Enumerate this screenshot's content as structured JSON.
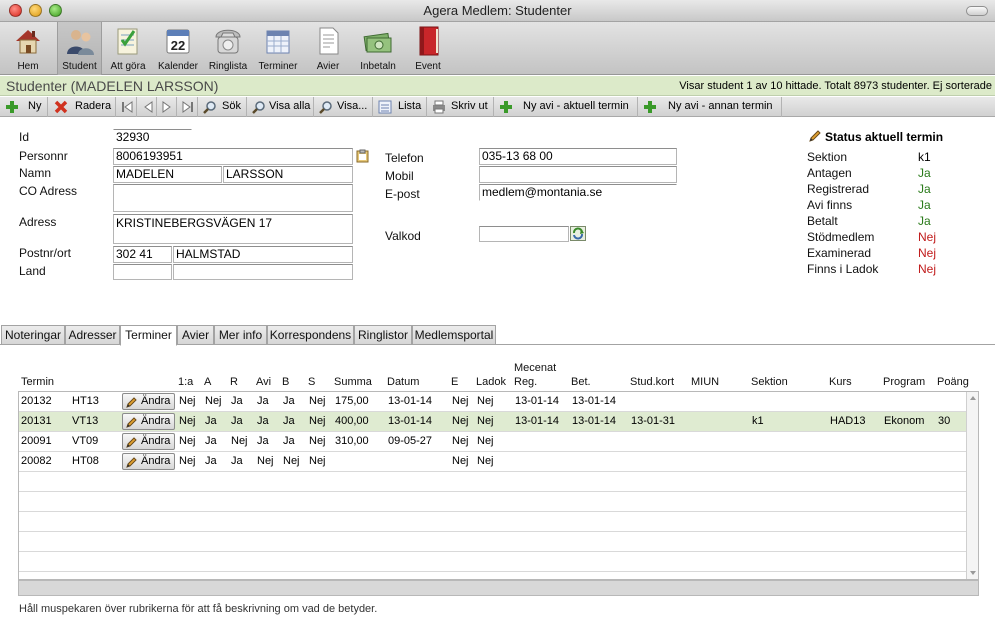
{
  "window": {
    "title": "Agera Medlem: Studenter"
  },
  "toolbar": {
    "items": [
      {
        "label": "Hem",
        "icon": "house-icon"
      },
      {
        "label": "Student",
        "icon": "students-icon"
      },
      {
        "label": "Att göra",
        "icon": "todo-icon"
      },
      {
        "label": "Kalender",
        "icon": "calendar-icon",
        "badge": "22"
      },
      {
        "label": "Ringlista",
        "icon": "phone-icon"
      },
      {
        "label": "Terminer",
        "icon": "terms-icon"
      },
      {
        "label": "Avier",
        "icon": "document-icon"
      },
      {
        "label": "Inbetaln",
        "icon": "money-icon"
      },
      {
        "label": "Event",
        "icon": "event-book-icon"
      }
    ]
  },
  "header": {
    "title": "Studenter (MADELEN LARSSON)",
    "count_text": "Visar student 1 av 10 hittade. Totalt 8973 studenter. Ej sorterade"
  },
  "actions": {
    "new": "Ny",
    "delete": "Radera",
    "search": "Sök",
    "show_all": "Visa alla",
    "show": "Visa...",
    "list": "Lista",
    "print": "Skriv ut",
    "new_invoice_current": "Ny avi - aktuell termin",
    "new_invoice_other": "Ny avi - annan termin"
  },
  "form": {
    "labels": {
      "id": "Id",
      "personnr": "Personnr",
      "name": "Namn",
      "co_address": "CO Adress",
      "address": "Adress",
      "postnr": "Postnr/ort",
      "country": "Land",
      "phone": "Telefon",
      "mobile": "Mobil",
      "email": "E-post",
      "valkod": "Valkod"
    },
    "values": {
      "id": "32930",
      "personnr": "8006193951",
      "first_name": "MADELEN",
      "last_name": "LARSSON",
      "co_address": "",
      "address": "KRISTINEBERGSVÄGEN 17",
      "postnr": "302 41",
      "city": "HALMSTAD",
      "country": "",
      "country2": "",
      "phone": "035-13 68 00",
      "mobile": "",
      "email": "medlem@montania.se",
      "valkod": ""
    }
  },
  "status": {
    "title": "Status aktuell termin",
    "colors": {
      "yes": "#2a7a1a",
      "no": "#c01a1a"
    },
    "items": [
      {
        "label": "Sektion",
        "value": "k1",
        "kind": "plain"
      },
      {
        "label": "Antagen",
        "value": "Ja",
        "kind": "yes"
      },
      {
        "label": "Registrerad",
        "value": "Ja",
        "kind": "yes"
      },
      {
        "label": "Avi finns",
        "value": "Ja",
        "kind": "yes"
      },
      {
        "label": "Betalt",
        "value": "Ja",
        "kind": "yes"
      },
      {
        "label": "Stödmedlem",
        "value": "Nej",
        "kind": "no"
      },
      {
        "label": "Examinerad",
        "value": "Nej",
        "kind": "no"
      },
      {
        "label": "Finns i Ladok",
        "value": "Nej",
        "kind": "no"
      }
    ]
  },
  "tabs": [
    {
      "label": "Noteringar",
      "active": false
    },
    {
      "label": "Adresser",
      "active": false
    },
    {
      "label": "Terminer",
      "active": true
    },
    {
      "label": "Avier",
      "active": false
    },
    {
      "label": "Mer info",
      "active": false
    },
    {
      "label": "Korrespondens",
      "active": false
    },
    {
      "label": "Ringlistor",
      "active": false
    },
    {
      "label": "Medlemsportal",
      "active": false
    }
  ],
  "table": {
    "headers": {
      "termin": "Termin",
      "first": "1:a",
      "a": "A",
      "r": "R",
      "avi": "Avi",
      "b": "B",
      "s": "S",
      "summa": "Summa",
      "datum": "Datum",
      "e": "E",
      "ladok": "Ladok",
      "mecenat_top": "Mecenat",
      "reg": "Reg.",
      "bet": "Bet.",
      "studkort": "Stud.kort",
      "miun": "MIUN",
      "sektion": "Sektion",
      "kurs": "Kurs",
      "program": "Program",
      "poang": "Poäng"
    },
    "edit_label": "Ändra",
    "rows": [
      {
        "termin": "20132",
        "code": "HT13",
        "first": "Nej",
        "a": "Nej",
        "r": "Ja",
        "avi": "Ja",
        "b": "Ja",
        "s": "Nej",
        "summa": "175,00",
        "datum": "13-01-14",
        "e": "Nej",
        "ladok": "Nej",
        "reg": "13-01-14",
        "bet": "13-01-14",
        "studkort": "",
        "miun": "",
        "sektion": "",
        "kurs": "",
        "program": "",
        "poang": "",
        "selected": false
      },
      {
        "termin": "20131",
        "code": "VT13",
        "first": "Nej",
        "a": "Ja",
        "r": "Ja",
        "avi": "Ja",
        "b": "Ja",
        "s": "Nej",
        "summa": "400,00",
        "datum": "13-01-14",
        "e": "Nej",
        "ladok": "Nej",
        "reg": "13-01-14",
        "bet": "13-01-14",
        "studkort": "13-01-31",
        "miun": "",
        "sektion": "k1",
        "kurs": "HAD13",
        "program": "Ekonom",
        "poang": "30",
        "selected": true
      },
      {
        "termin": "20091",
        "code": "VT09",
        "first": "Nej",
        "a": "Ja",
        "r": "Nej",
        "avi": "Ja",
        "b": "Ja",
        "s": "Nej",
        "summa": "310,00",
        "datum": "09-05-27",
        "e": "Nej",
        "ladok": "Nej",
        "reg": "",
        "bet": "",
        "studkort": "",
        "miun": "",
        "sektion": "",
        "kurs": "",
        "program": "",
        "poang": "",
        "selected": false
      },
      {
        "termin": "20082",
        "code": "HT08",
        "first": "Nej",
        "a": "Ja",
        "r": "Ja",
        "avi": "Nej",
        "b": "Nej",
        "s": "Nej",
        "summa": "",
        "datum": "",
        "e": "Nej",
        "ladok": "Nej",
        "reg": "",
        "bet": "",
        "studkort": "",
        "miun": "",
        "sektion": "",
        "kurs": "",
        "program": "",
        "poang": "",
        "selected": false
      }
    ],
    "empty_rows": 5
  },
  "hint": "Håll muspekaren över rubrikerna för att få beskrivning om vad de betyder."
}
